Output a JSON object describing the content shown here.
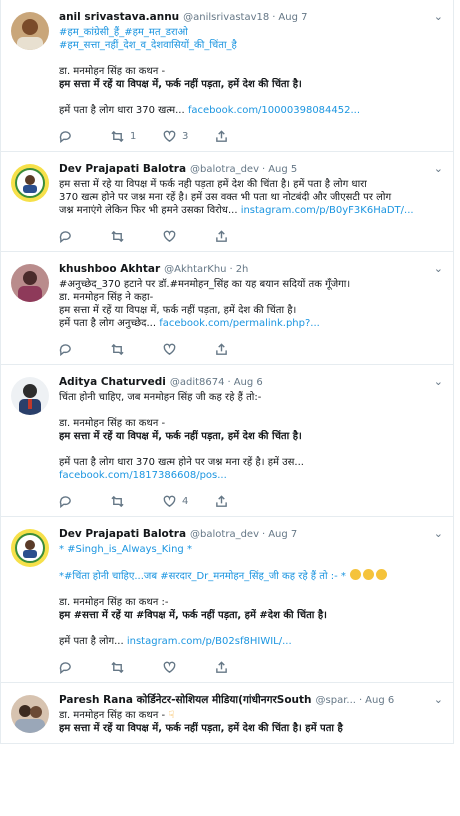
{
  "tweets": [
    {
      "name": "anil srivastava.annu",
      "handle": "@anilsrivastav18",
      "time": "Aug 7",
      "lines": [
        "#हम_कांग्रेसी_हैं_#हम_मत_डराओ",
        "#हम_सत्ता_नहीं_देश_व_देशवासियों_की_चिंता_है",
        "",
        "डा. मनमोहन सिंह का कथन -",
        "हम सत्ता में रहें या विपक्ष में, फर्क नहीं पड़ता, हमें देश की चिंता है।",
        "",
        "हमें पता है लोग धारा 370 खत्म...",
        "facebook.com/10000398084452..."
      ],
      "reply_count": "",
      "retweet_count": "1",
      "like_count": "3"
    },
    {
      "name": "Dev Prajapati Balotra",
      "handle": "@balotra_dev",
      "time": "Aug 5",
      "lines": [
        "हम सत्ता में रहे या विपक्ष में फर्क नही पड़ता हमें देश की चिंता है। हमें पता है लोग धारा",
        "370 खत्म होने पर जश्न मना रहें है। हमें उस वक्त भी पता था नोटबंदी और जीएसटी पर लोग",
        "जश्न मनाएंगे लेकिन फिर भी हमने उसका विरोध...",
        "instagram.com/p/B0yF3K6HaDT/..."
      ],
      "reply_count": "",
      "retweet_count": "",
      "like_count": ""
    },
    {
      "name": "khushboo Akhtar",
      "handle": "@AkhtarKhu",
      "time": "2h",
      "lines": [
        "#अनुच्छेद_370 हटाने पर डॉ.#मनमोहन_सिंह का यह बयान सदियों तक गूँजेगा।",
        "डा. मनमोहन सिंह ने कहा-",
        " हम सत्ता में रहें या विपक्ष में, फर्क नहीं पड़ता, हमें देश की चिंता है।",
        "हमें पता है लोग अनुच्छेद...",
        "facebook.com/permalink.php?..."
      ],
      "reply_count": "",
      "retweet_count": "",
      "like_count": ""
    },
    {
      "name": "Aditya Chaturvedi",
      "handle": "@adit8674",
      "time": "Aug 6",
      "lines": [
        "चिंता होनी चाहिए, जब मनमोहन सिंह जी कह रहे हैं तो:-",
        "",
        "डा. मनमोहन सिंह का कथन -",
        "हम सत्ता में रहें या विपक्ष में, फर्क नहीं पड़ता, हमें देश की चिंता है।",
        "",
        "हमें पता है लोग धारा 370 खत्म होने पर जश्न मना रहें है। हमें उस...",
        "facebook.com/1817386608/pos..."
      ],
      "reply_count": "",
      "retweet_count": "",
      "like_count": "4"
    },
    {
      "name": "Dev Prajapati Balotra",
      "handle": "@balotra_dev",
      "time": "Aug 7",
      "lines": [
        "* #Singh_is_Always_King *",
        "",
        "*#चिंता होनी चाहिए...जब #सरदार_Dr_मनमोहन_सिंह_जी कह रहे हैं तो :- *",
        "",
        "डा. मनमोहन सिंह का कथन :-",
        "हम #सत्ता में रहें या #विपक्ष में, फर्क नहीं पड़ता, हमें #देश की चिंता है।",
        "",
        "हमें पता है लोग...",
        "instagram.com/p/B02sf8HIWIL/..."
      ],
      "reply_count": "",
      "retweet_count": "",
      "like_count": ""
    },
    {
      "name": "Paresh Rana कोर्डिनेटर-सोशियल मीडिया(गांधीनगरSouth",
      "handle": "@spar...",
      "time": "Aug 6",
      "lines": [
        "डा. मनमोहन सिंह का कथन -",
        "हम सत्ता में रहें या विपक्ष में, फर्क नहीं पड़ता, हमें देश की चिंता है। हमें पता है"
      ],
      "reply_count": "",
      "retweet_count": "",
      "like_count": ""
    }
  ],
  "colors": {
    "link": "#1b95e0",
    "muted": "#657786",
    "border": "#e6ecf0"
  },
  "icons": [
    "reply-icon",
    "retweet-icon",
    "like-icon",
    "share-icon",
    "chevron-down-icon"
  ]
}
